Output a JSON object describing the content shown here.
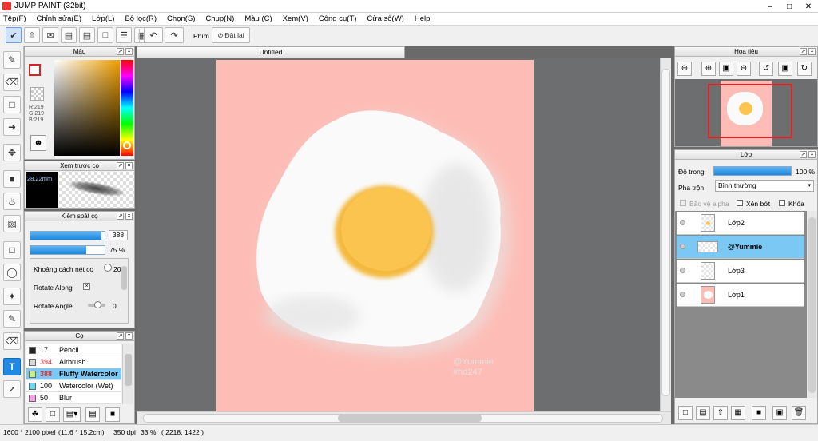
{
  "window": {
    "title": "JUMP PAINT (32bit)"
  },
  "menu": [
    "Tệp(F)",
    "Chỉnh sửa(E)",
    "Lớp(L)",
    "Bộ lọc(R)",
    "Chọn(S)",
    "Chụp(N)",
    "Màu (C)",
    "Xem(V)",
    "Công cụ(T)",
    "Cửa sổ(W)",
    "Help"
  ],
  "toolbar": {
    "finger_label": "Phím",
    "reset_label": "Đặt lại"
  },
  "color_panel": {
    "title": "Màu",
    "r": "R:219",
    "g": "G:219",
    "b": "B:219"
  },
  "brush_preview": {
    "title": "Xem trước cọ",
    "size": "28.22mm"
  },
  "brush_control": {
    "title": "Kiểm soát cọ",
    "size_value": "388",
    "opacity_value": "75 %",
    "opacity_fraction": 0.75,
    "size_fraction": 0.96,
    "spacing_label": "Khoảng cách nét cọ",
    "rotate_along_label": "Rotate Along",
    "rotate_angle_label": "Rotate Angle",
    "spacing_value": "20",
    "rotate_angle_value": "0"
  },
  "brush_list": {
    "title": "Cọ",
    "items": [
      {
        "num": "17",
        "name": "Pencil",
        "color": "#222222"
      },
      {
        "num": "394",
        "name": "Airbrush",
        "color": "#d9d9d9"
      },
      {
        "num": "388",
        "name": "Fluffy Watercolor",
        "color": "#c6f08a"
      },
      {
        "num": "100",
        "name": "Watercolor (Wet)",
        "color": "#6ad8f0"
      },
      {
        "num": "50",
        "name": "Blur",
        "color": "#f5a0e8"
      }
    ]
  },
  "document": {
    "tab": "Untitled",
    "watermark_line1": "@Yummie",
    "watermark_line2": "#hd247"
  },
  "navigator": {
    "title": "Hoa tiêu"
  },
  "layers": {
    "title": "Lớp",
    "opacity_label": "Độ trong",
    "opacity_value": "100 %",
    "blend_label": "Pha trộn",
    "blend_value": "Bình thường",
    "protect_alpha": "Bảo vệ alpha",
    "clip": "Xén bớt",
    "lock": "Khóa",
    "items": [
      {
        "name": "Lớp2"
      },
      {
        "name": "@Yummie"
      },
      {
        "name": "Lớp3"
      },
      {
        "name": "Lớp1"
      }
    ]
  },
  "status": {
    "size": "1600 * 2100 pixel",
    "cm": "(11.6 * 15.2cm)",
    "dpi": "350 dpi",
    "zoom": "33 %",
    "coords": "( 2218, 1422 )"
  }
}
